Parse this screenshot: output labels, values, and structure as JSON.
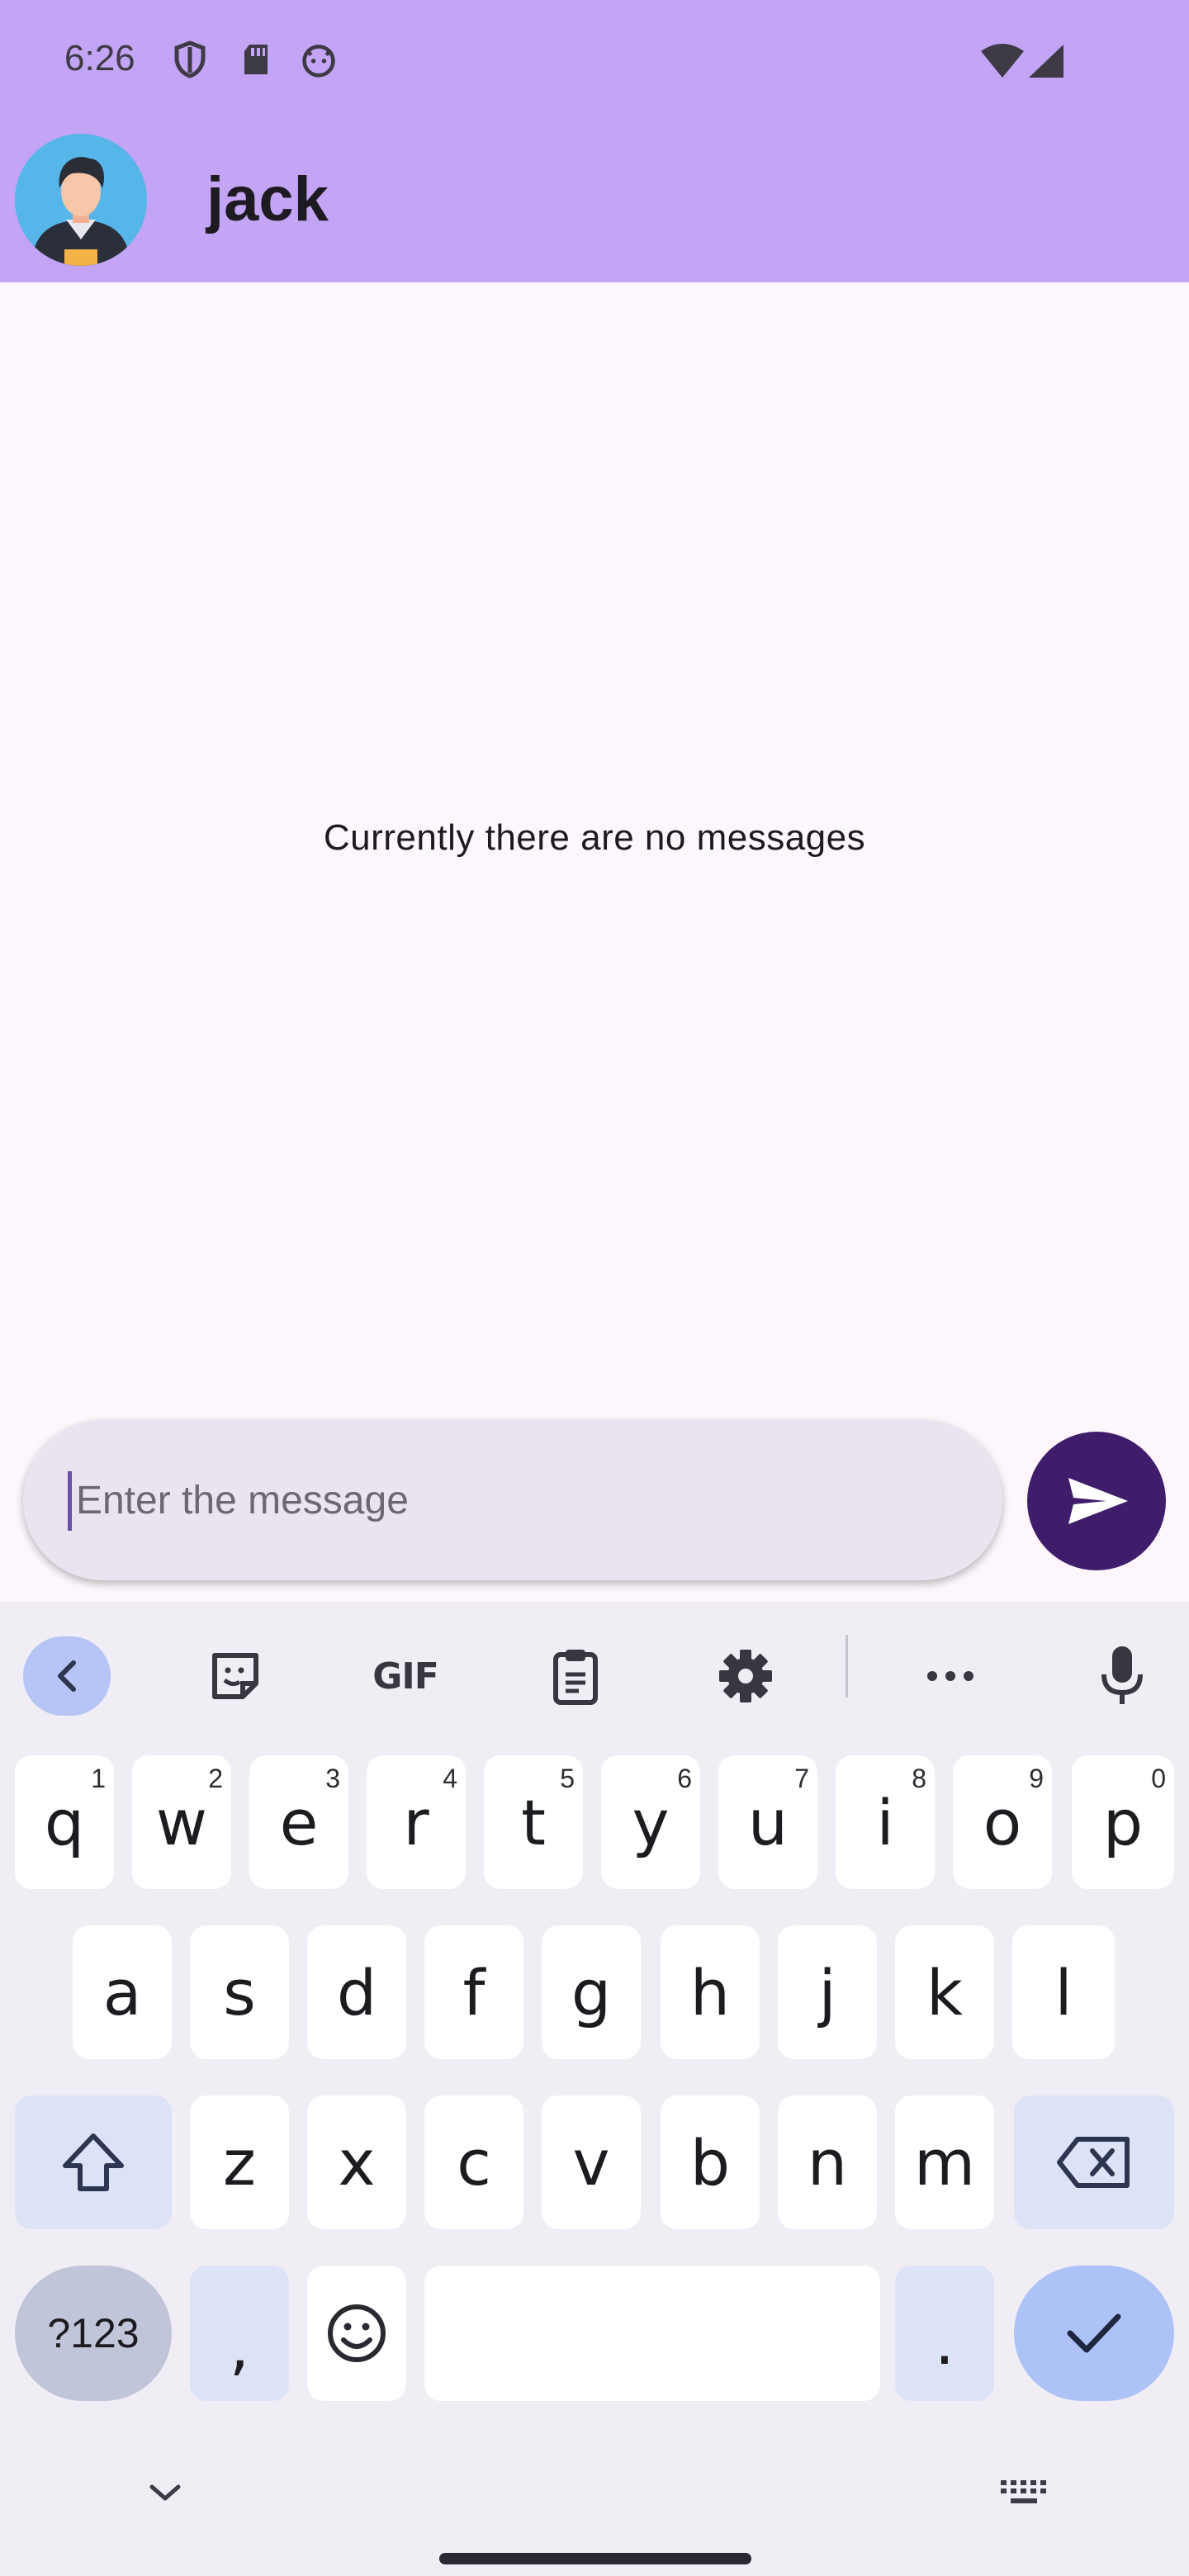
{
  "status_bar": {
    "time": "6:26"
  },
  "app_bar": {
    "contact_name": "jack"
  },
  "conversation": {
    "empty_text": "Currently there are no messages"
  },
  "composer": {
    "placeholder": "Enter the message",
    "value": ""
  },
  "keyboard": {
    "toolbar": [
      {
        "name": "back-icon"
      },
      {
        "name": "sticker-icon"
      },
      {
        "name": "gif-icon",
        "label": "GIF"
      },
      {
        "name": "clipboard-icon"
      },
      {
        "name": "settings-icon"
      },
      {
        "name": "more-icon"
      },
      {
        "name": "mic-icon"
      }
    ],
    "row1": [
      {
        "key": "q",
        "sup": "1"
      },
      {
        "key": "w",
        "sup": "2"
      },
      {
        "key": "e",
        "sup": "3"
      },
      {
        "key": "r",
        "sup": "4"
      },
      {
        "key": "t",
        "sup": "5"
      },
      {
        "key": "y",
        "sup": "6"
      },
      {
        "key": "u",
        "sup": "7"
      },
      {
        "key": "i",
        "sup": "8"
      },
      {
        "key": "o",
        "sup": "9"
      },
      {
        "key": "p",
        "sup": "0"
      }
    ],
    "row2": [
      "a",
      "s",
      "d",
      "f",
      "g",
      "h",
      "j",
      "k",
      "l"
    ],
    "row3": [
      "z",
      "x",
      "c",
      "v",
      "b",
      "n",
      "m"
    ],
    "symbols_label": "?123",
    "comma": ",",
    "period": "."
  },
  "colors": {
    "app_bar": "#c4a4f4",
    "background": "#fdf7fd",
    "send_button": "#3f1d6b",
    "composer": "#ebe4f0",
    "keyboard": "#f0edf5",
    "enter_key": "#adc2f6"
  }
}
